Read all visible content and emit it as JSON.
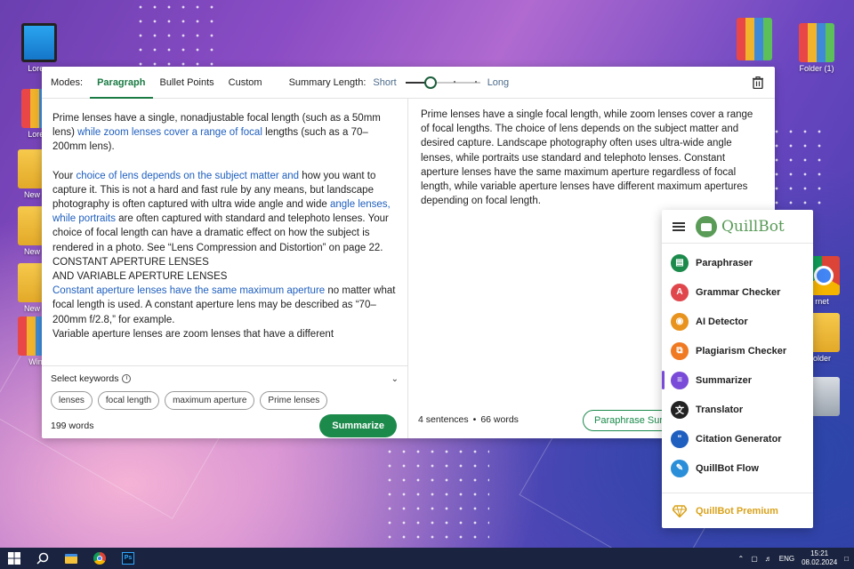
{
  "desktop": {
    "icons": [
      {
        "label": "Lorem",
        "type": "monitor"
      },
      {
        "label": "Lorem",
        "type": "binder"
      },
      {
        "label": "New F",
        "type": "folder"
      },
      {
        "label": "New F",
        "type": "folder"
      },
      {
        "label": "New F",
        "type": "folder"
      },
      {
        "label": "Win",
        "type": "binder"
      },
      {
        "label": "",
        "type": "binder"
      },
      {
        "label": "Folder (1)",
        "type": "binder"
      },
      {
        "label": "rnet",
        "type": "chrome"
      },
      {
        "label": "older",
        "type": "folder"
      },
      {
        "label": "",
        "type": "trash"
      }
    ]
  },
  "toolbar": {
    "modes_label": "Modes:",
    "modes": [
      "Paragraph",
      "Bullet Points",
      "Custom"
    ],
    "active_mode": "Paragraph",
    "summary_length_label": "Summary Length:",
    "short_label": "Short",
    "long_label": "Long",
    "summary_length_level": 0.3
  },
  "input": {
    "p1_a": "Prime lenses have a single, nonadjustable focal length (such as a 50mm lens) ",
    "p1_hl": "while zoom lenses cover a range of focal",
    "p1_b": " lengths (such as a 70–200mm lens).",
    "p2_a": "Your ",
    "p2_hl1": "choice of lens depends on the subject matter and",
    "p2_b": " how you want to capture it. This is not a hard and fast rule by any means, but landscape photography is often captured with ultra wide angle and wide ",
    "p2_hl2": "angle lenses, while portraits",
    "p2_c": " are often captured with standard and telephoto lenses. Your choice of focal length can have a dramatic effect on how the subject is rendered in a photo. See “Lens Compression and Distortion” on page 22.",
    "line_caps1": "CONSTANT APERTURE LENSES",
    "line_caps2": "AND VARIABLE APERTURE LENSES",
    "p3_hl": "Constant aperture lenses have the same maximum aperture",
    "p3_a": " no matter what focal length is used. A constant aperture lens may be described as “70–200mm f/2.8,” for example.",
    "p4": "Variable aperture lenses are zoom lenses that have a different"
  },
  "keywords": {
    "label": "Select keywords",
    "chips": [
      "lenses",
      "focal length",
      "maximum aperture",
      "Prime lenses"
    ]
  },
  "left_footer": {
    "word_count": "199 words",
    "summarize_button": "Summarize"
  },
  "output": {
    "text": "Prime lenses have a single focal length, while zoom lenses cover a range of focal lengths. The choice of lens depends on the subject matter and desired capture. Landscape photography often uses ultra-wide angle lenses, while portraits use standard and telephoto lenses. Constant aperture lenses have the same maximum aperture regardless of focal length, while variable aperture lenses have different maximum apertures depending on focal length.",
    "sentences": "4 sentences",
    "words": "66 words",
    "paraphrase_button": "Paraphrase Summary"
  },
  "quillbot_menu": {
    "brand": "QuillBot",
    "items": [
      {
        "label": "Paraphraser",
        "icon": "paraphraser-icon",
        "color": "#1b8a4b"
      },
      {
        "label": "Grammar Checker",
        "icon": "grammar-icon",
        "color": "#e0474c"
      },
      {
        "label": "AI Detector",
        "icon": "ai-detector-icon",
        "color": "#e8931e"
      },
      {
        "label": "Plagiarism Checker",
        "icon": "plagiarism-icon",
        "color": "#ef7a22"
      },
      {
        "label": "Summarizer",
        "icon": "summarizer-icon",
        "color": "#7a4bd8"
      },
      {
        "label": "Translator",
        "icon": "translator-icon",
        "color": "#222222"
      },
      {
        "label": "Citation Generator",
        "icon": "citation-icon",
        "color": "#1f5fbf"
      },
      {
        "label": "QuillBot Flow",
        "icon": "flow-icon",
        "color": "#2a8fd8"
      }
    ],
    "active": "Summarizer",
    "premium": "QuillBot Premium"
  },
  "taskbar": {
    "lang": "ENG",
    "time": "15:21",
    "date": "08.02.2024"
  }
}
